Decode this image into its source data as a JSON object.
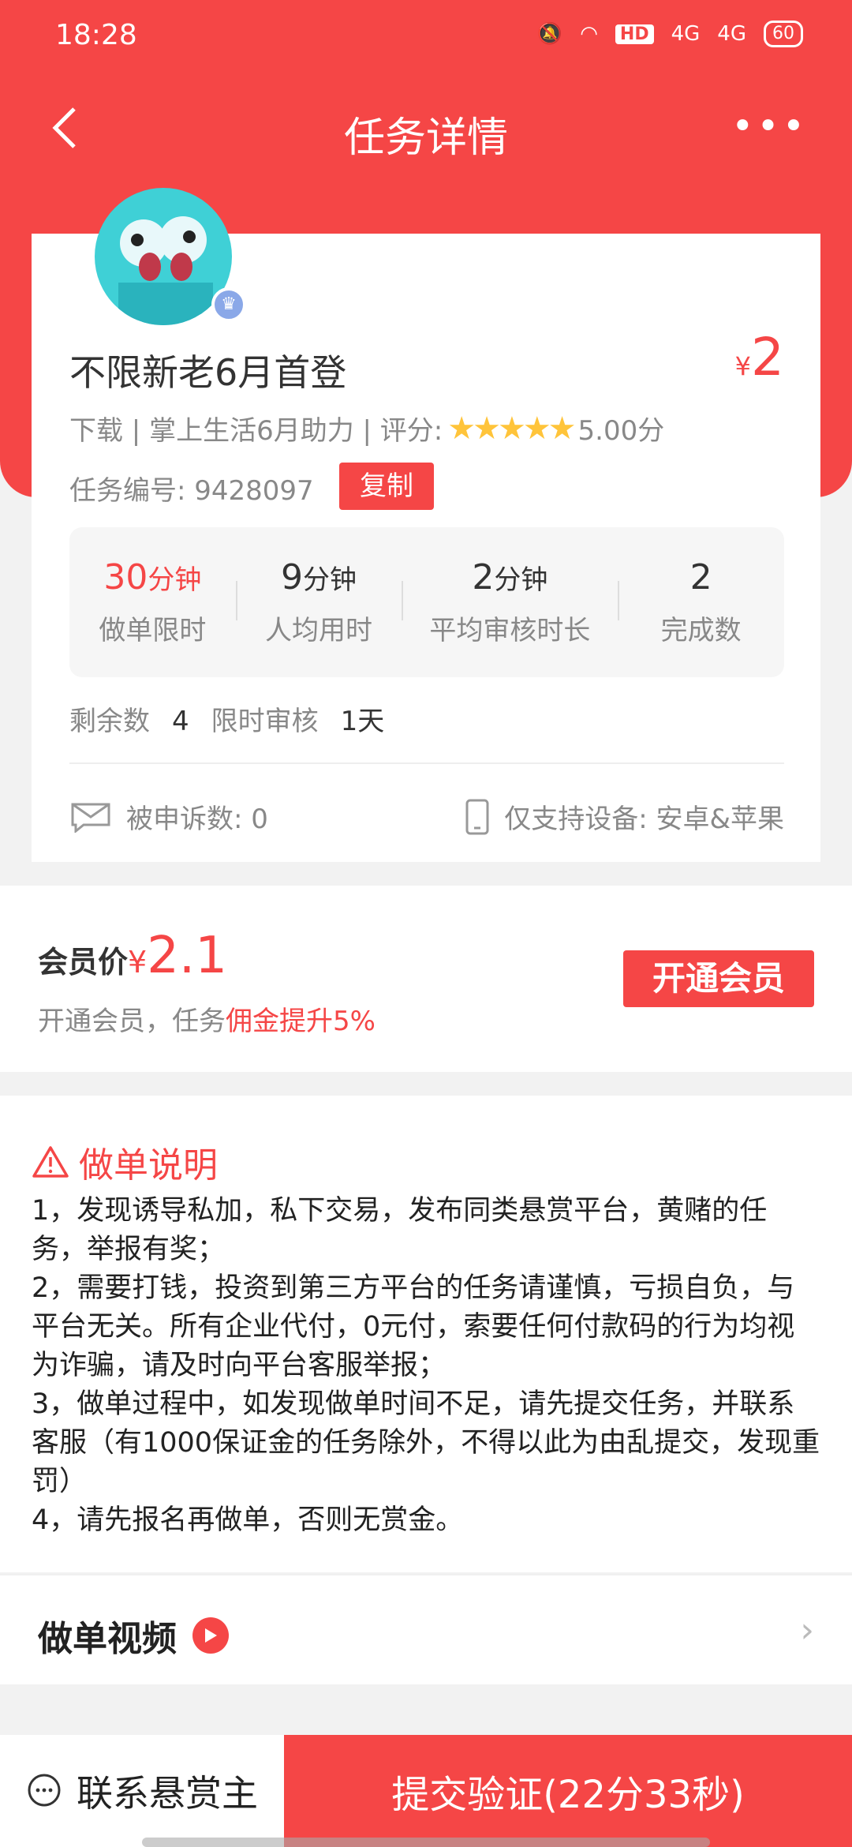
{
  "status_bar": {
    "time": "18:28",
    "hd": "HD",
    "net1": "4G",
    "net2": "4G",
    "battery": "60"
  },
  "nav": {
    "title": "任务详情"
  },
  "task": {
    "title": "不限新老6月首登",
    "price_symbol": "¥",
    "price": "2",
    "meta": "下载 | 掌上生活6月助力 | 评分:",
    "stars": "★★★★★",
    "rating": "5.00分",
    "number_label": "任务编号: 9428097",
    "copy_label": "复制"
  },
  "stats": [
    {
      "value": "30",
      "unit": "分钟",
      "label": "做单限时"
    },
    {
      "value": "9",
      "unit": "分钟",
      "label": "人均用时"
    },
    {
      "value": "2",
      "unit": "分钟",
      "label": "平均审核时长"
    },
    {
      "value": "2",
      "unit": "",
      "label": "完成数"
    }
  ],
  "remain": {
    "label": "剩余数",
    "value": "4",
    "review_label": "限时审核",
    "review_value": "1天"
  },
  "complaint": "被申诉数: 0",
  "device": "仅支持设备: 安卓&苹果",
  "member": {
    "label": "会员价",
    "symbol": "¥",
    "price": "2.1",
    "desc_prefix": "开通会员，任务",
    "desc_highlight": "佣金提升5%",
    "button": "开通会员"
  },
  "instructions": {
    "title": "做单说明",
    "items": [
      "1，发现诱导私加，私下交易，发布同类悬赏平台，黄赌的任务，举报有奖；",
      "2，需要打钱，投资到第三方平台的任务请谨慎，亏损自负，与平台无关。所有企业代付，0元付，索要任何付款码的行为均视为诈骗，请及时向平台客服举报；",
      "3，做单过程中，如发现做单时间不足，请先提交任务，并联系客服（有1000保证金的任务除外，不得以此为由乱提交，发现重罚）",
      "4，请先报名再做单，否则无赏金。"
    ]
  },
  "video": {
    "label": "做单视频"
  },
  "bottom": {
    "contact": "联系悬赏主",
    "submit": "提交验证(22分33秒)"
  },
  "colors": {
    "accent": "#f54646",
    "star": "#ffc43a"
  }
}
